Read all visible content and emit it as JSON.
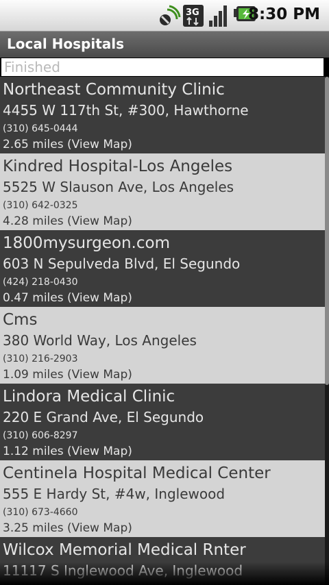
{
  "status_bar": {
    "time": "8:30 PM",
    "network_label": "3G",
    "icons": [
      "sync-icon",
      "network-3g-icon",
      "signal-icon",
      "battery-charging-icon"
    ]
  },
  "app": {
    "title": "Local Hospitals"
  },
  "progress": {
    "text": "Finished"
  },
  "hospitals": [
    {
      "name": "Northeast Community Clinic",
      "address": "4455 W 117th St, #300, Hawthorne",
      "phone": "(310) 645-0444",
      "distance": "2.65 miles (View Map)"
    },
    {
      "name": "Kindred Hospital-Los Angeles",
      "address": "5525 W Slauson Ave, Los Angeles",
      "phone": "(310) 642-0325",
      "distance": "4.28 miles (View Map)"
    },
    {
      "name": "1800mysurgeon.com",
      "address": "603 N Sepulveda Blvd, El Segundo",
      "phone": "(424) 218-0430",
      "distance": "0.47 miles (View Map)"
    },
    {
      "name": "Cms",
      "address": "380 World Way, Los Angeles",
      "phone": "(310) 216-2903",
      "distance": "1.09 miles (View Map)"
    },
    {
      "name": "Lindora Medical Clinic",
      "address": "220 E Grand Ave, El Segundo",
      "phone": "(310) 606-8297",
      "distance": "1.12 miles (View Map)"
    },
    {
      "name": "Centinela Hospital Medical Center",
      "address": "555 E Hardy St, #4w, Inglewood",
      "phone": "(310) 673-4660",
      "distance": "3.25 miles (View Map)"
    },
    {
      "name": "Wilcox Memorial Medical Rnter",
      "address": "11117 S Inglewood Ave, Inglewood",
      "phone": "",
      "distance": ""
    }
  ]
}
